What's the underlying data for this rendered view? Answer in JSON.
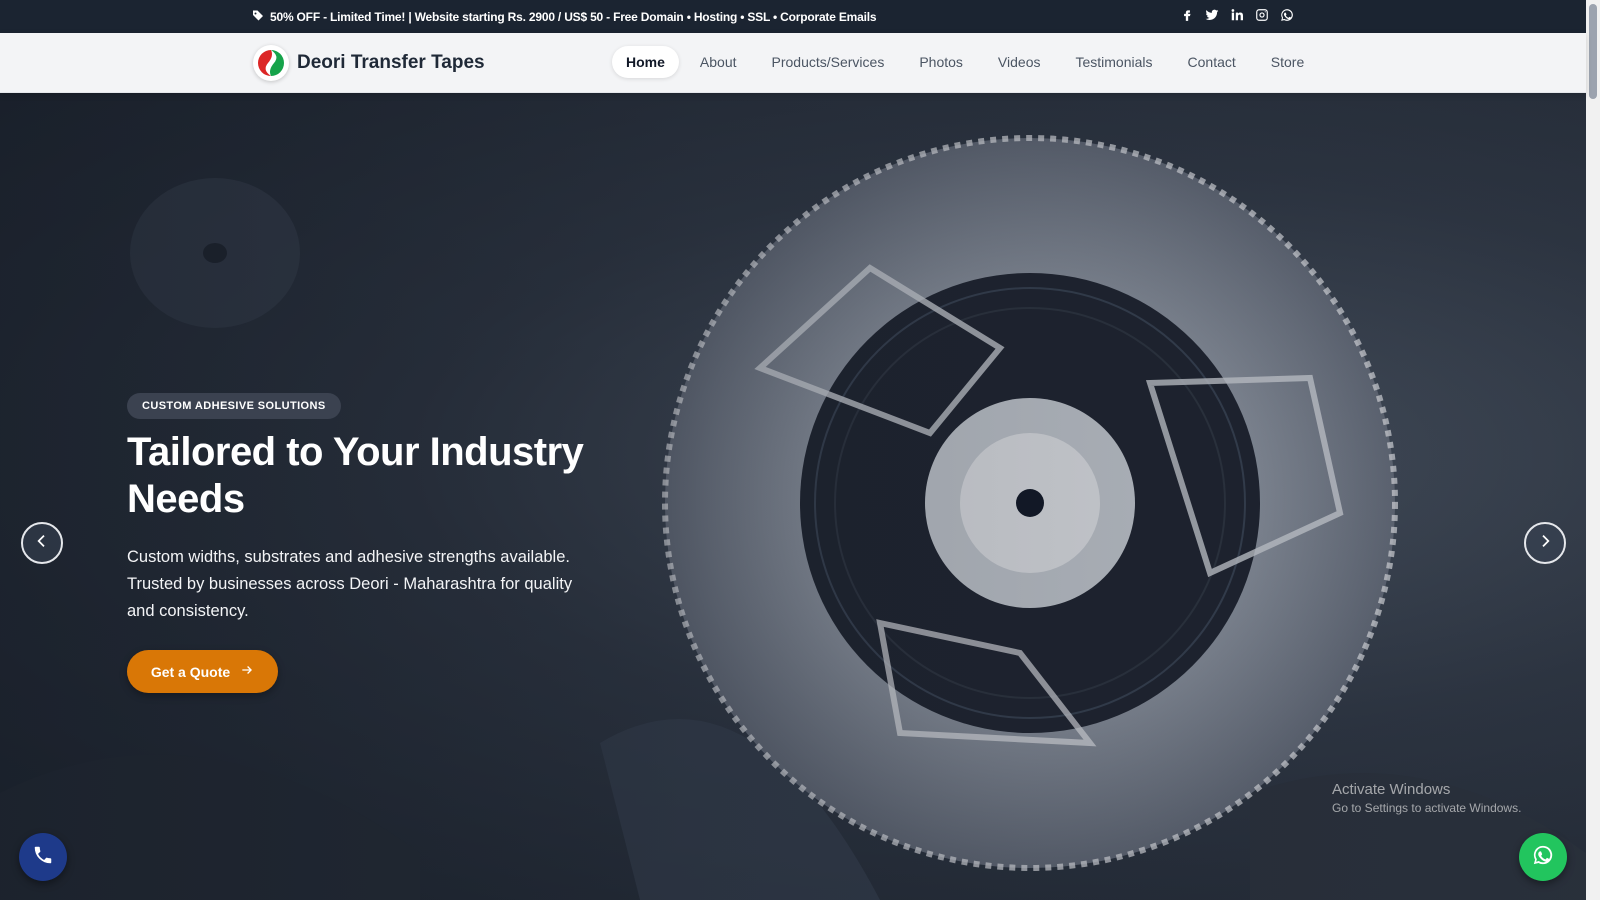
{
  "topbar": {
    "promo_text": "50% OFF - Limited Time! | Website starting Rs. 2900 / US$ 50 - Free Domain • Hosting • SSL • Corporate Emails",
    "socials": [
      "facebook-icon",
      "twitter-icon",
      "linkedin-icon",
      "instagram-icon",
      "whatsapp-icon"
    ]
  },
  "navbar": {
    "brand_name": "Deori Transfer Tapes",
    "items": [
      {
        "label": "Home",
        "active": true
      },
      {
        "label": "About"
      },
      {
        "label": "Products/Services"
      },
      {
        "label": "Photos"
      },
      {
        "label": "Videos"
      },
      {
        "label": "Testimonials"
      },
      {
        "label": "Contact"
      },
      {
        "label": "Store"
      }
    ]
  },
  "hero": {
    "badge": "CUSTOM ADHESIVE SOLUTIONS",
    "headline": "Tailored to Your Industry Needs",
    "subtext": "Custom widths, substrates and adhesive strengths available. Trusted by businesses across Deori - Maharashtra for quality and consistency.",
    "cta_label": "Get a Quote"
  },
  "watermark": {
    "title": "Activate Windows",
    "subtitle": "Go to Settings to activate Windows."
  },
  "colors": {
    "topbar": "#1b2431",
    "accent": "#d97706",
    "call_button": "#1e3a8a",
    "whatsapp_button": "#22c55e"
  }
}
